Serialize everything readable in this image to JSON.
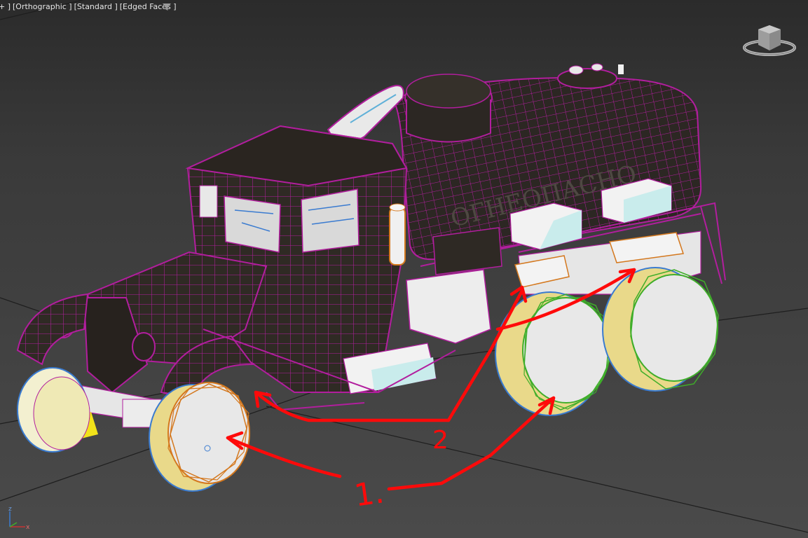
{
  "viewport": {
    "menu_plus": "+ ]",
    "view_label": "[Orthographic ]",
    "shading_label": "[Standard ]",
    "edge_label": "[Edged Faces ]"
  },
  "annotations": {
    "label_1": "1.",
    "label_2": "2"
  },
  "axis": {
    "z_label": "z",
    "x_label": "x"
  },
  "colors": {
    "wire": "#b21e9e",
    "body_dark": "#2f2a24",
    "annotation": "#ff0a0a",
    "wheel_front": "#d4781e",
    "wheel_rear": "#3fae2a"
  }
}
